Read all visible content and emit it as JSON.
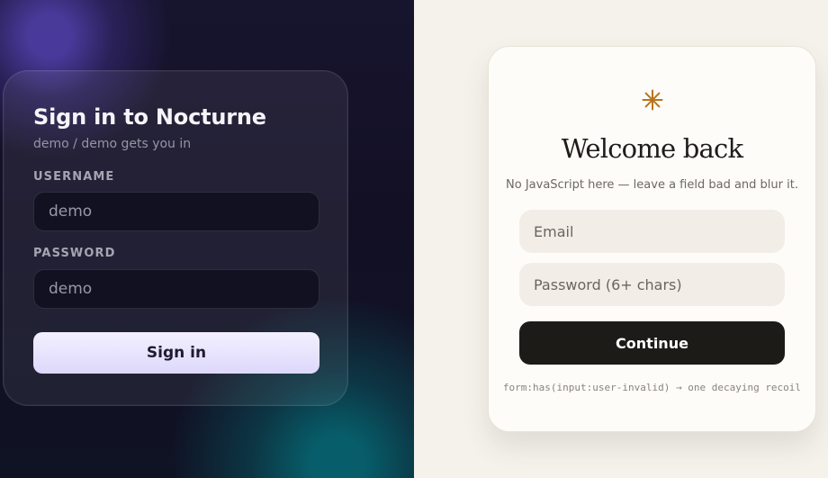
{
  "left_form": {
    "title": "Sign in to Nocturne",
    "subtitle": "demo / demo gets you in",
    "username_label": "USERNAME",
    "username_value": "demo",
    "password_label": "PASSWORD",
    "password_value": "demo",
    "submit_label": "Sign in"
  },
  "right_form": {
    "icon_name": "asterisk-icon",
    "icon_color": "#b8741f",
    "title": "Welcome back",
    "subtitle": "No JavaScript here — leave a field bad and blur it.",
    "email_placeholder": "Email",
    "password_placeholder": "Password (6+ chars)",
    "submit_label": "Continue",
    "footnote": "form:has(input:user-invalid) → one decaying recoil"
  },
  "colors": {
    "left_background": "#131025",
    "left_button_top": "#f3f0ff",
    "left_button_bottom": "#ddd8fb",
    "right_background": "#f5f2ec",
    "right_button": "#1d1b18"
  }
}
